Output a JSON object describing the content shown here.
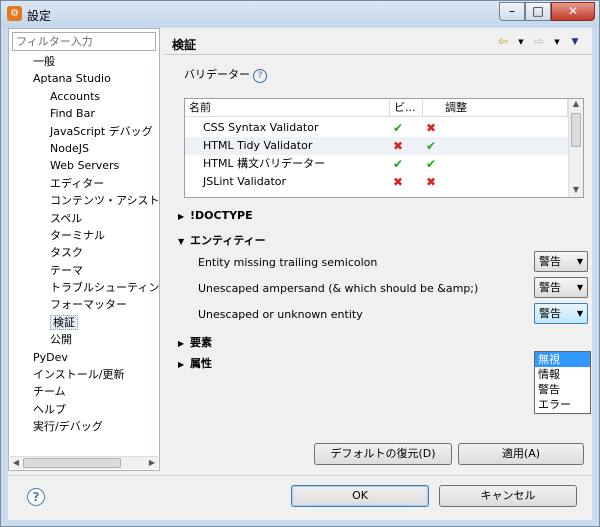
{
  "window": {
    "title": "設定",
    "title_icon": "gear-icon",
    "controls": [
      "minimize",
      "maximize",
      "close"
    ]
  },
  "sidebar": {
    "filter_placeholder": "フィルター入力",
    "items": [
      {
        "label": "一般",
        "level": 0
      },
      {
        "label": "Aptana Studio",
        "level": 0
      },
      {
        "label": "Accounts",
        "level": 1
      },
      {
        "label": "Find Bar",
        "level": 1
      },
      {
        "label": "JavaScript デバッグ",
        "level": 1
      },
      {
        "label": "NodeJS",
        "level": 1
      },
      {
        "label": "Web Servers",
        "level": 1
      },
      {
        "label": "エディター",
        "level": 1
      },
      {
        "label": "コンテンツ・アシスト",
        "level": 1
      },
      {
        "label": "スペル",
        "level": 1
      },
      {
        "label": "ターミナル",
        "level": 1
      },
      {
        "label": "タスク",
        "level": 1
      },
      {
        "label": "テーマ",
        "level": 1
      },
      {
        "label": "トラブルシューティング",
        "level": 1
      },
      {
        "label": "フォーマッター",
        "level": 1
      },
      {
        "label": "検証",
        "level": 1,
        "selected": true
      },
      {
        "label": "公開",
        "level": 1
      },
      {
        "label": "PyDev",
        "level": 0
      },
      {
        "label": "インストール/更新",
        "level": 0
      },
      {
        "label": "チーム",
        "level": 0
      },
      {
        "label": "ヘルプ",
        "level": 0
      },
      {
        "label": "実行/デバッグ",
        "level": 0
      }
    ]
  },
  "main": {
    "title": "検証",
    "nav": {
      "back": "⇦",
      "forward": "⇨",
      "menu": "▼"
    },
    "validators_label": "バリデーター",
    "help_glyph": "?",
    "table": {
      "headers": [
        "名前",
        "ビ...",
        "調整"
      ],
      "rows": [
        {
          "name": "CSS Syntax Validator",
          "build": "ok",
          "tune": "x"
        },
        {
          "name": "HTML Tidy Validator",
          "build": "x",
          "tune": "ok",
          "selected": true
        },
        {
          "name": "HTML 構文バリデーター",
          "build": "ok",
          "tune": "ok"
        },
        {
          "name": "JSLint Validator",
          "build": "x",
          "tune": "x"
        }
      ]
    },
    "sections": {
      "doctype": "!DOCTYPE",
      "entities": "エンティティー",
      "elements": "要素",
      "attributes": "属性"
    },
    "entity_options": [
      {
        "label": "Entity missing trailing semicolon",
        "value": "警告"
      },
      {
        "label": "Unescaped ampersand (& which should be &amp;)",
        "value": "警告"
      },
      {
        "label": "Unescaped or unknown entity",
        "value": "警告"
      }
    ],
    "dropdown_options": [
      "無視",
      "情報",
      "警告",
      "エラー"
    ],
    "dropdown_highlight": "無視",
    "restore_defaults": "デフォルトの復元(D)",
    "apply": "適用(A)"
  },
  "footer": {
    "help_glyph": "?",
    "ok": "OK",
    "cancel": "キャンセル"
  },
  "colors": {
    "frame": "#c9dbed",
    "accent": "#3399ff",
    "ok_check": "#1fa31f",
    "error_x": "#d62424"
  }
}
